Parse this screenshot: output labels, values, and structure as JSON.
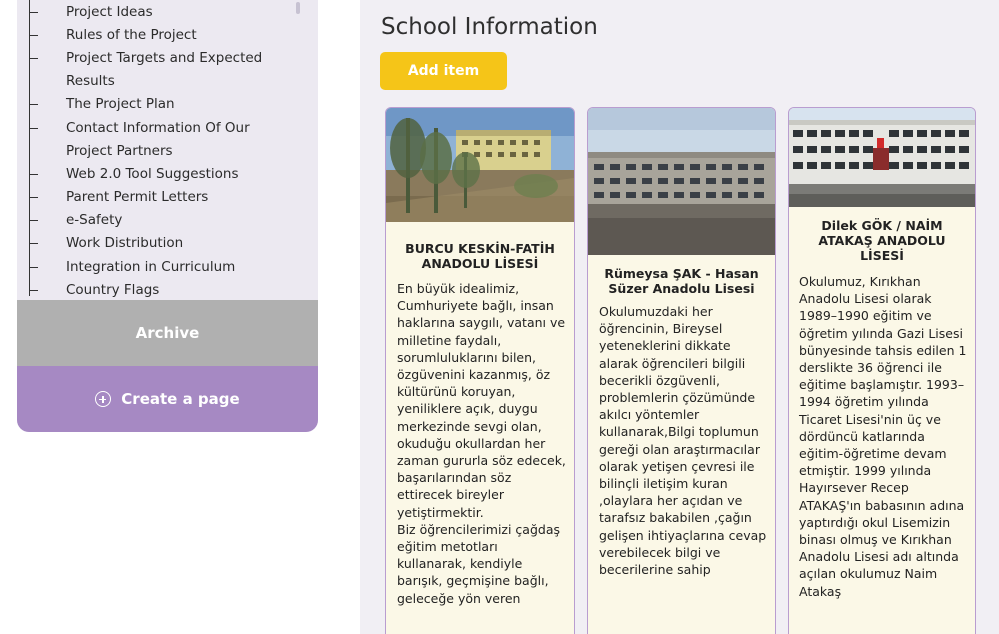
{
  "sidebar": {
    "items": [
      {
        "label": "Project Ideas"
      },
      {
        "label": "Rules of the Project"
      },
      {
        "label": "Project Targets and Expected"
      },
      {
        "label": "Results"
      },
      {
        "label": "The Project Plan"
      },
      {
        "label": "Contact Information Of Our"
      },
      {
        "label": "Project Partners"
      },
      {
        "label": "Web 2.0 Tool Suggestions"
      },
      {
        "label": "Parent Permit Letters"
      },
      {
        "label": "e-Safety"
      },
      {
        "label": "Work Distribution"
      },
      {
        "label": "Integration in Curriculum"
      },
      {
        "label": "Country Flags"
      }
    ],
    "archive_label": "Archive",
    "create_label": "Create a page"
  },
  "main": {
    "title": "School Information",
    "add_label": "Add item"
  },
  "cards": [
    {
      "title": "BURCU KESKİN-FATİH ANADOLU LİSESİ",
      "body": "En büyük idealimiz, Cumhuriyete bağlı, insan haklarına saygılı, vatanı ve milletine faydalı, sorumluluklarını bilen, özgüvenini kazanmış, öz kültürünü koruyan, yeniliklere açık, duygu merkezinde sevgi olan, okuduğu okullardan her zaman gururla söz edecek, başarılarından söz ettirecek bireyler yetiştirmektir.\nBiz öğrencilerimizi çağdaş eğitim metotları kullanarak, kendiyle barışık, geçmişine bağlı, geleceğe yön veren"
    },
    {
      "title": "Rümeysa ŞAK - Hasan Süzer Anadolu Lisesi",
      "body": "Okulumuzdaki her öğrencinin, Bireysel yeteneklerini dikkate alarak öğrencileri bilgili becerikli özgüvenli, problemlerin çözümünde akılcı yöntemler kullanarak,Bilgi toplumun gereği olan araştırmacılar olarak yetişen çevresi ile bilinçli iletişim kuran ,olaylara her açıdan ve tarafsız bakabilen ,çağın gelişen ihtiyaçlarına cevap verebilecek bilgi ve becerilerine sahip"
    },
    {
      "title": "Dilek GÖK / NAİM ATAKAŞ ANADOLU LİSESİ",
      "body": "Okulumuz, Kırıkhan Anadolu Lisesi olarak 1989–1990 eğitim ve öğretim yılında Gazi Lisesi bünyesinde tahsis edilen 1 derslikte 36 öğrenci ile eğitime başlamıştır. 1993–1994 öğretim yılında Ticaret Lisesi'nin üç ve dördüncü katlarında eğitim-öğretime devam etmiştir. 1999 yılında Hayırsever Recep ATAKAŞ'ın babasının adına yaptırdığı okul Lisemizin binası olmuş ve Kırıkhan Anadolu Lisesi adı altında açılan okulumuz Naim Atakaş"
    }
  ]
}
